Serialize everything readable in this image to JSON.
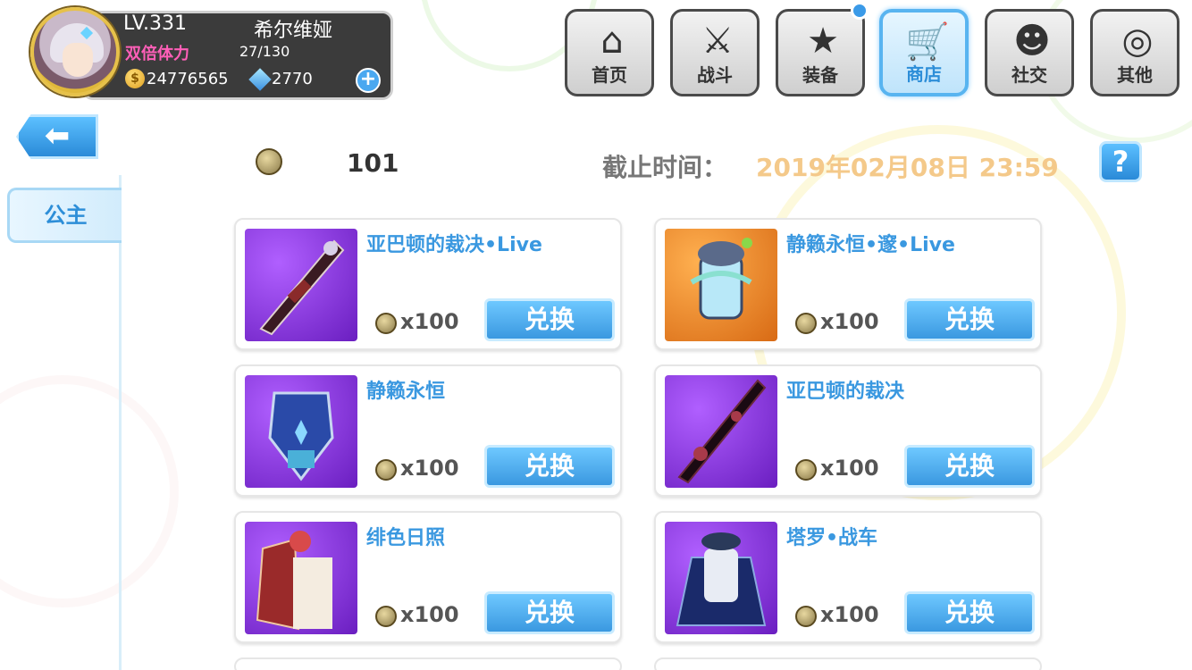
{
  "player": {
    "level": "LV.331",
    "name": "希尔维娅",
    "stamina_label": "双倍体力",
    "stamina_text": "27/130",
    "stamina_fraction": 0.208,
    "gold": "24776565",
    "gems": "2770",
    "gold_symbol": "$",
    "plus_symbol": "+"
  },
  "nav": [
    {
      "label": "首页",
      "icon": "home-icon",
      "glyph": "⌂"
    },
    {
      "label": "战斗",
      "icon": "swords-icon",
      "glyph": "⚔"
    },
    {
      "label": "装备",
      "icon": "gun-star-icon",
      "glyph": "★"
    },
    {
      "label": "商店",
      "icon": "shop-cart-icon",
      "glyph": "🛒"
    },
    {
      "label": "社交",
      "icon": "social-face-icon",
      "glyph": "☻"
    },
    {
      "label": "其他",
      "icon": "gear-other-icon",
      "glyph": "◎"
    }
  ],
  "sidebar": {
    "back_symbol": "⬅",
    "tab_label": "公主"
  },
  "shop": {
    "currency_value": "101",
    "deadline_label": "截止时间：",
    "deadline_value": "2019年02月08日 23:59",
    "help_symbol": "?"
  },
  "items": [
    {
      "title": "亚巴顿的裁决•Live",
      "price": "x100",
      "button": "兑换",
      "bg": "purple"
    },
    {
      "title": "静籁永恒•邃•Live",
      "price": "x100",
      "button": "兑换",
      "bg": "orange"
    },
    {
      "title": "静籁永恒",
      "price": "x100",
      "button": "兑换",
      "bg": "purple"
    },
    {
      "title": "亚巴顿的裁决",
      "price": "x100",
      "button": "兑换",
      "bg": "purple"
    },
    {
      "title": "绯色日照",
      "price": "x100",
      "button": "兑换",
      "bg": "purple"
    },
    {
      "title": "塔罗•战车",
      "price": "x100",
      "button": "兑换",
      "bg": "purple"
    }
  ],
  "colors": {
    "accent": "#3a98e0",
    "stamina": "#ff5fb8",
    "deadline": "#f4c98a"
  }
}
